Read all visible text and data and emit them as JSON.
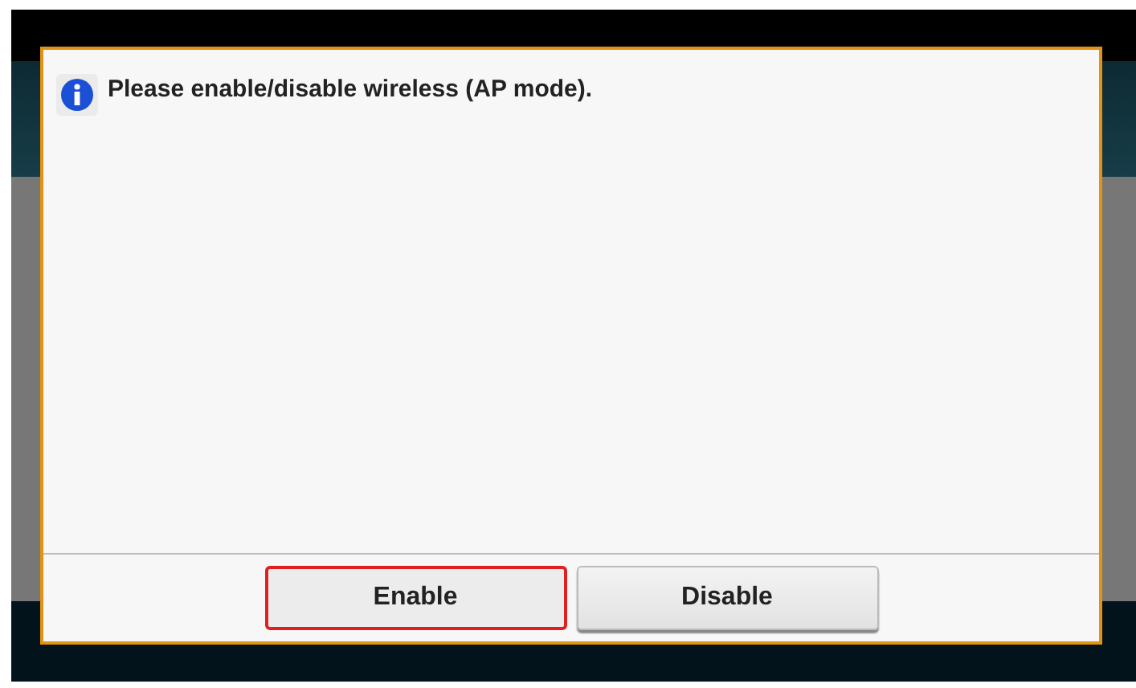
{
  "dialog": {
    "message": "Please enable/disable wireless (AP mode).",
    "buttons": [
      {
        "label": "Enable",
        "selected": true
      },
      {
        "label": "Disable",
        "selected": false
      }
    ]
  }
}
